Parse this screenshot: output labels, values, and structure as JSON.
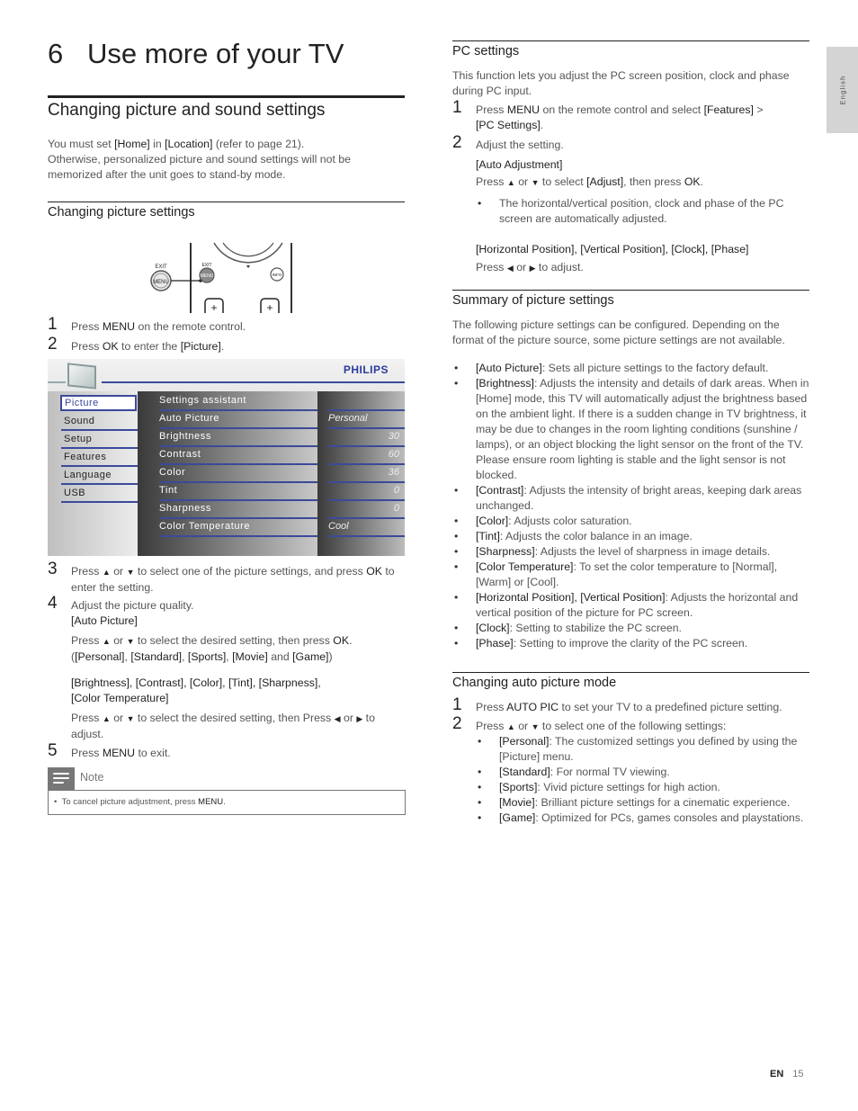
{
  "chapter": {
    "number": "6",
    "title": "Use more of your TV"
  },
  "section_title": "Changing picture and sound settings",
  "intro": {
    "parts": [
      "You must set ",
      "[Home]",
      " in ",
      "[Location]",
      " (refer to page 21).",
      "Otherwise, personalized picture and sound settings will not be memorized after the unit goes to stand-by mode."
    ]
  },
  "picture_settings": {
    "heading": "Changing picture settings",
    "remote": {
      "exit_label": "EXIT",
      "menu_label": "MENU",
      "info_label": "INFO",
      "plus": "+"
    },
    "steps": [
      {
        "num": "1",
        "parts": [
          "Press ",
          "MENU",
          " on the remote control."
        ]
      },
      {
        "num": "2",
        "parts": [
          "Press ",
          "OK",
          " to enter the ",
          "[Picture]",
          "."
        ]
      },
      {
        "num": "3",
        "parts": [
          "Press ",
          "▲",
          " or ",
          "▼",
          " to select one of the picture settings, and press ",
          "OK",
          " to enter the setting."
        ]
      },
      {
        "num": "4",
        "text": "Adjust the picture quality."
      },
      {
        "num": "5",
        "parts": [
          "Press ",
          "MENU",
          " to exit."
        ]
      }
    ],
    "auto_picture": {
      "title": "[Auto Picture]",
      "line1": [
        "Press ",
        "▲",
        " or ",
        "▼",
        " to select the desired setting, then press ",
        "OK",
        "."
      ],
      "line2": [
        "(",
        "[Personal]",
        ", ",
        "[Standard]",
        ", ",
        "[Sports]",
        ", ",
        "[Movie]",
        " and ",
        "[Game]",
        ")"
      ]
    },
    "other_settings": {
      "title_line1": "[Brightness], [Contrast], [Color], [Tint], [Sharpness],",
      "title_line2": "[Color Temperature]",
      "line": [
        "Press ",
        "▲",
        " or ",
        "▼",
        " to select the desired setting, then Press ",
        "◀",
        " or ",
        "▶",
        " to adjust."
      ]
    },
    "note": {
      "label": "Note",
      "text_parts": [
        "To cancel picture adjustment, press ",
        "MENU",
        "."
      ]
    }
  },
  "osd": {
    "brand": "PHILIPS",
    "left_menu": [
      "Picture",
      "Sound",
      "Setup",
      "Features",
      "Language",
      "USB"
    ],
    "selected": "Picture",
    "middle_menu": [
      "Settings assistant",
      "Auto Picture",
      "Brightness",
      "Contrast",
      "Color",
      "Tint",
      "Sharpness",
      "Color Temperature"
    ],
    "values": [
      "",
      "Personal",
      "30",
      "60",
      "36",
      "0",
      "0",
      "Cool"
    ]
  },
  "pc_settings": {
    "heading": "PC settings",
    "intro": "This function lets you adjust the PC screen position, clock and phase during PC input.",
    "step1": [
      "Press ",
      "MENU",
      " on the remote control and select ",
      "[Features]",
      " > ",
      "[PC Settings]",
      "."
    ],
    "step2": "Adjust the setting.",
    "auto_adjustment": {
      "title": "[Auto Adjustment]",
      "line": [
        "Press ",
        "▲",
        " or ",
        "▼",
        " to select ",
        "[Adjust]",
        ", then press ",
        "OK",
        "."
      ],
      "bullet": "The horizontal/vertical position, clock and phase of the PC screen are automatically adjusted."
    },
    "position": {
      "title": "[Horizontal Position], [Vertical Position], [Clock], [Phase]",
      "line": [
        "Press ",
        "◀",
        " or ",
        "▶",
        " to adjust."
      ]
    }
  },
  "summary": {
    "heading": "Summary of picture settings",
    "intro": "The following picture settings can be configured. Depending on the format of the picture source, some picture settings are not available.",
    "items": [
      {
        "term": "[Auto Picture]",
        "desc": ": Sets all picture settings to the factory default."
      },
      {
        "term": "[Brightness]",
        "desc": ": Adjusts the intensity and details of dark areas. When in [Home] mode, this TV will automatically adjust the brightness based on the ambient light. If there is a sudden change in TV brightness, it may be due to changes in the room lighting conditions (sunshine / lamps), or an object blocking the light sensor on the front of the TV. Please ensure room lighting is stable and the light sensor is not blocked."
      },
      {
        "term": "[Contrast]",
        "desc": ": Adjusts the intensity of bright areas, keeping dark areas unchanged."
      },
      {
        "term": "[Color]",
        "desc": ": Adjusts color saturation."
      },
      {
        "term": "[Tint]",
        "desc": ": Adjusts the color balance in an image."
      },
      {
        "term": "[Sharpness]",
        "desc": ": Adjusts the level of sharpness in image details."
      },
      {
        "term": "[Color Temperature]",
        "desc": ": To set the color temperature to [Normal], [Warm] or [Cool]."
      },
      {
        "term": "[Horizontal Position], [Vertical Position]",
        "desc": ": Adjusts the horizontal and vertical position of the picture for PC screen."
      },
      {
        "term": "[Clock]",
        "desc": ": Setting to stabilize the PC screen."
      },
      {
        "term": "[Phase]",
        "desc": ": Setting to improve the clarity of the PC screen."
      }
    ]
  },
  "auto_picture_mode": {
    "heading": "Changing auto picture mode",
    "step1": [
      "Press ",
      "AUTO PIC",
      " to set your TV to a predefined picture setting."
    ],
    "step2": [
      "Press ",
      "▲",
      " or ",
      "▼",
      " to select one of the following settings:"
    ],
    "items": [
      {
        "term": "[Personal]",
        "desc": ": The customized settings you defined by using the [Picture] menu."
      },
      {
        "term": "[Standard]",
        "desc": ": For normal TV viewing."
      },
      {
        "term": "[Sports]",
        "desc": ": Vivid picture settings for high action."
      },
      {
        "term": "[Movie]",
        "desc": ": Brilliant picture settings for a cinematic experience."
      },
      {
        "term": "[Game]",
        "desc": ": Optimized for PCs, games consoles and playstations."
      }
    ]
  },
  "side_tab": "English",
  "footer": {
    "lang": "EN",
    "page": "15"
  }
}
